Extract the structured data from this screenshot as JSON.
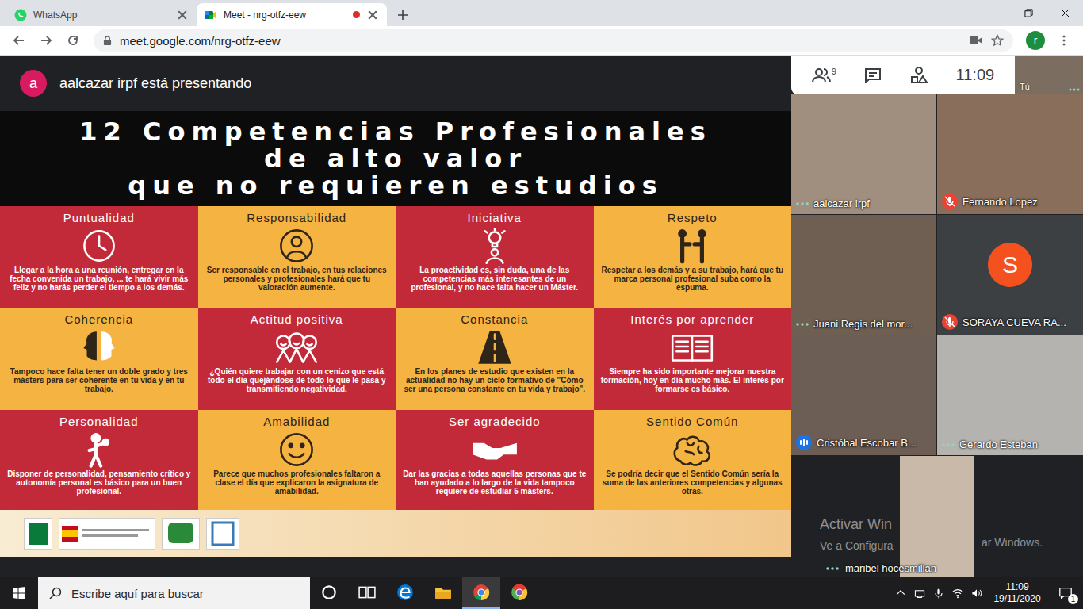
{
  "browser": {
    "tabs": [
      {
        "label": "WhatsApp",
        "selected": false,
        "kind": "whatsapp",
        "recording": false
      },
      {
        "label": "Meet - nrg-otfz-eew",
        "selected": true,
        "kind": "meet",
        "recording": true
      }
    ],
    "url": "meet.google.com/nrg-otfz-eew",
    "profile_initial": "r"
  },
  "meet": {
    "presenter_initial": "a",
    "presenting_text": "aalcazar irpf está presentando",
    "participant_count": "9",
    "time": "11:09",
    "self_label": "Tú"
  },
  "slide": {
    "title_lines": [
      "12 Competencias Profesionales",
      "de alto valor",
      "que no requieren estudios"
    ],
    "cells": [
      {
        "title": "Puntualidad",
        "text": "Llegar a la hora a una reunión, entregar en la fecha convenida un trabajo, ... te hará vivir más feliz y no harás perder el tiempo a los demás.",
        "color": "#c22a3a"
      },
      {
        "title": "Responsabilidad",
        "text": "Ser responsable en el trabajo, en tus relaciones personales y profesionales hará que tu valoración aumente.",
        "color": "#f5b342"
      },
      {
        "title": "Iniciativa",
        "text": "La proactividad es, sin duda, una de las competencias más interesantes de un profesional, y no hace falta hacer un Máster.",
        "color": "#c22a3a"
      },
      {
        "title": "Respeto",
        "text": "Respetar a los demás y a su trabajo, hará que tu marca personal profesional suba como la espuma.",
        "color": "#f5b342"
      },
      {
        "title": "Coherencia",
        "text": "Tampoco hace falta tener un doble grado y tres másters para ser coherente en tu vida y en tu trabajo.",
        "color": "#f5b342"
      },
      {
        "title": "Actitud positiva",
        "text": "¿Quién quiere trabajar con un cenizo que está todo el día quejándose de todo lo que le pasa y transmitiendo negatividad.",
        "color": "#c22a3a"
      },
      {
        "title": "Constancia",
        "text": "En los planes de estudio que existen en la actualidad no hay un ciclo formativo de \"Cómo ser una persona constante en tu vida y trabajo\".",
        "color": "#f5b342"
      },
      {
        "title": "Interés por aprender",
        "text": "Siempre ha sido importante mejorar nuestra formación, hoy en día mucho más. El interés por formarse es básico.",
        "color": "#c22a3a"
      },
      {
        "title": "Personalidad",
        "text": "Disponer de personalidad, pensamiento crítico y autonomía personal es básico para un buen profesional.",
        "color": "#c22a3a"
      },
      {
        "title": "Amabilidad",
        "text": "Parece que muchos profesionales faltaron a clase el día que explicaron la asignatura de amabilidad.",
        "color": "#f5b342"
      },
      {
        "title": "Ser agradecido",
        "text": "Dar las gracias a todas aquellas personas que te han ayudado a lo largo de la vida tampoco requiere de estudiar 5 másters.",
        "color": "#c22a3a"
      },
      {
        "title": "Sentido Común",
        "text": "Se podría decir que el Sentido Común sería la suma de las anteriores competencias y algunas otras.",
        "color": "#f5b342"
      }
    ]
  },
  "participants": [
    {
      "name": "aalcazar irpf",
      "muted": false,
      "speaking": false,
      "kind": "video"
    },
    {
      "name": "Fernando Lopez",
      "muted": true,
      "speaking": false,
      "kind": "video"
    },
    {
      "name": "Juani Regis del mor...",
      "muted": false,
      "speaking": false,
      "kind": "video"
    },
    {
      "name": "SORAYA CUEVA RA...",
      "muted": true,
      "speaking": false,
      "kind": "avatar",
      "initial": "S",
      "color": "#f4511e"
    },
    {
      "name": "Cristóbal Escobar B...",
      "muted": false,
      "speaking": true,
      "kind": "video"
    },
    {
      "name": "Gerardo Esteban",
      "muted": false,
      "speaking": false,
      "kind": "video"
    },
    {
      "name": "maribel hocesmillan",
      "muted": false,
      "speaking": false,
      "kind": "video"
    }
  ],
  "watermark": {
    "title": "Activar Win",
    "line_left": "Ve a Configura",
    "line_right": "ar Windows."
  },
  "taskbar": {
    "search_placeholder": "Escribe aquí para buscar",
    "apps": [
      {
        "kind": "cortana",
        "active": false
      },
      {
        "kind": "taskview",
        "active": false
      },
      {
        "kind": "edge",
        "active": false
      },
      {
        "kind": "explorer",
        "active": false
      },
      {
        "kind": "chrome",
        "active": true
      },
      {
        "kind": "chrome-alt",
        "active": false
      }
    ],
    "time": "11:09",
    "date": "19/11/2020",
    "notifications": "1"
  }
}
